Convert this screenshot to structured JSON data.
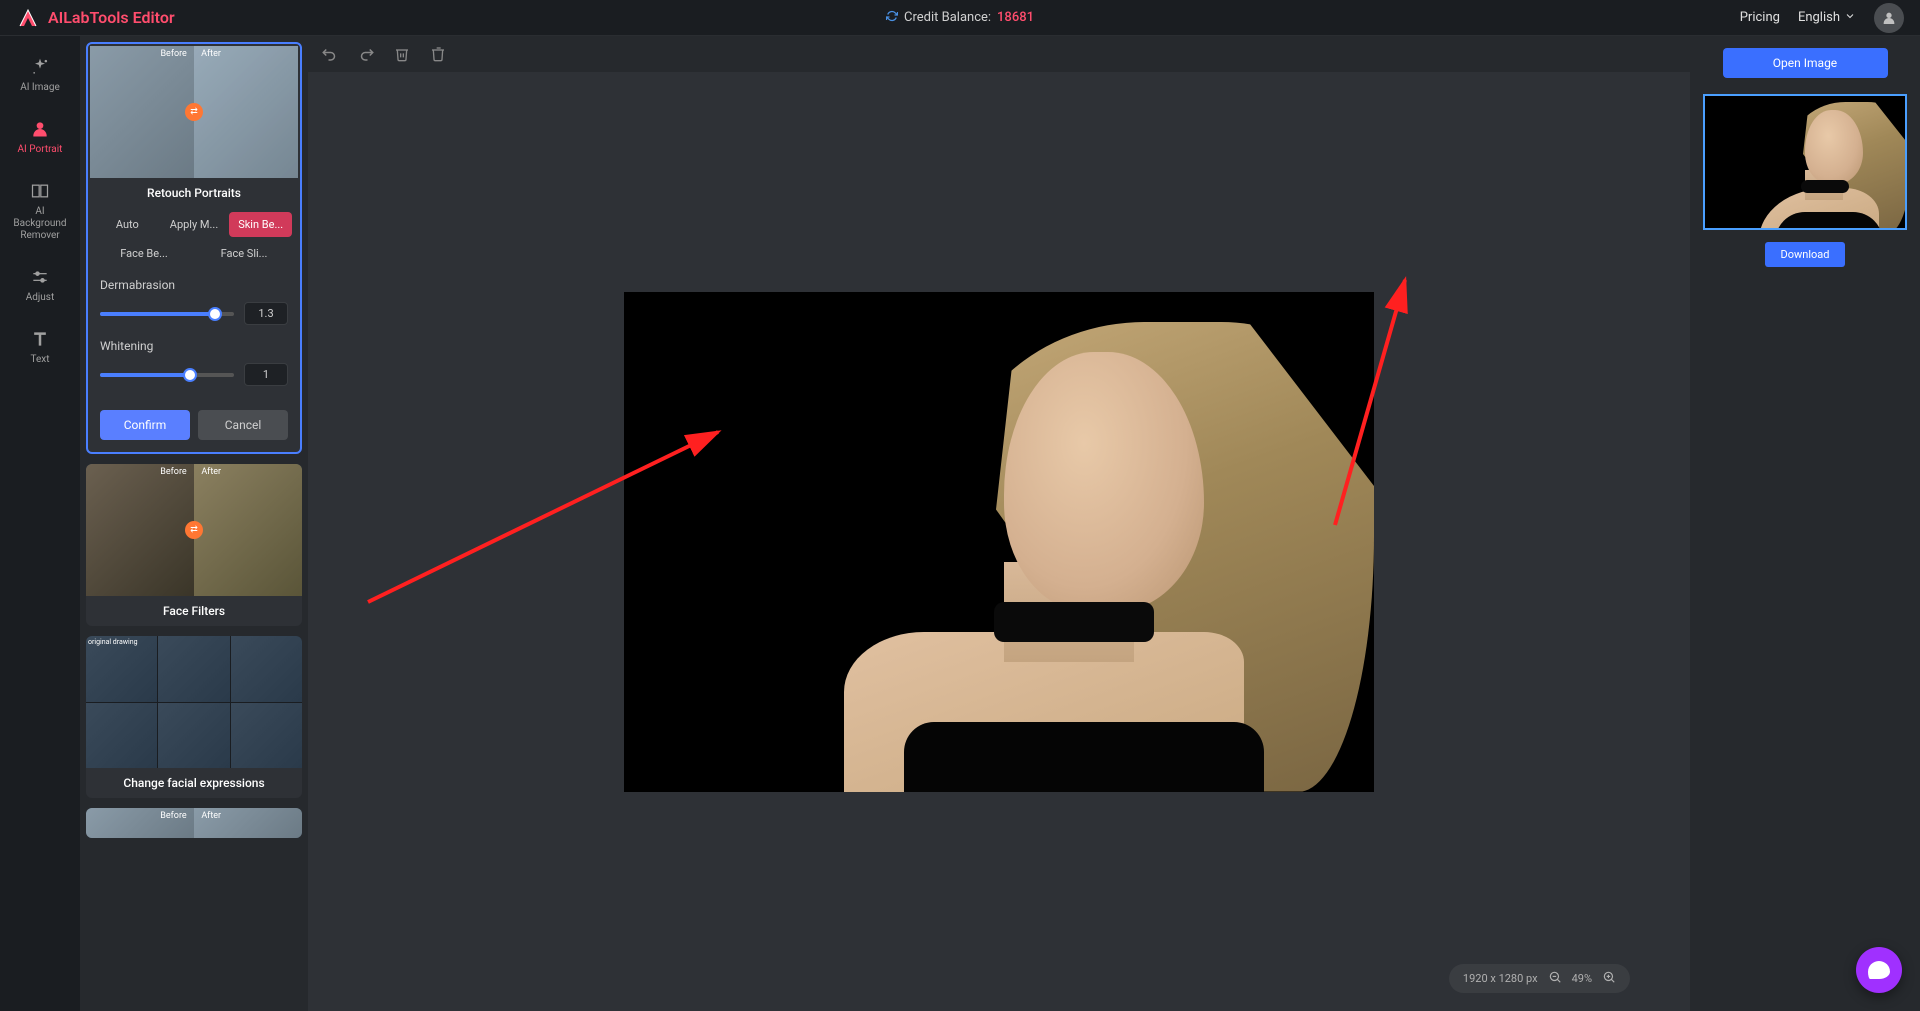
{
  "header": {
    "app_name": "AILabTools Editor",
    "credit_label": "Credit Balance:",
    "credit_value": "18681",
    "pricing": "Pricing",
    "language": "English"
  },
  "nav": {
    "items": [
      {
        "label": "AI Image"
      },
      {
        "label": "AI Portrait"
      },
      {
        "label": "AI Background Remover"
      },
      {
        "label": "Adjust"
      },
      {
        "label": "Text"
      }
    ]
  },
  "panel": {
    "compare": {
      "before": "Before",
      "after": "After"
    },
    "retouch": {
      "title": "Retouch Portraits",
      "modes": [
        "Auto",
        "Apply M...",
        "Skin Be...",
        "Face Be...",
        "Face Sli..."
      ],
      "sliders": [
        {
          "label": "Dermabrasion",
          "value": "1.3",
          "fill_pct": 86
        },
        {
          "label": "Whitening",
          "value": "1",
          "fill_pct": 67
        }
      ],
      "confirm": "Confirm",
      "cancel": "Cancel"
    },
    "filters": {
      "title": "Face Filters"
    },
    "expr": {
      "title": "Change facial expressions",
      "cell0": "original drawing"
    }
  },
  "canvas": {
    "dimensions": "1920 x 1280 px",
    "zoom": "49%"
  },
  "right": {
    "open": "Open Image",
    "download": "Download"
  }
}
